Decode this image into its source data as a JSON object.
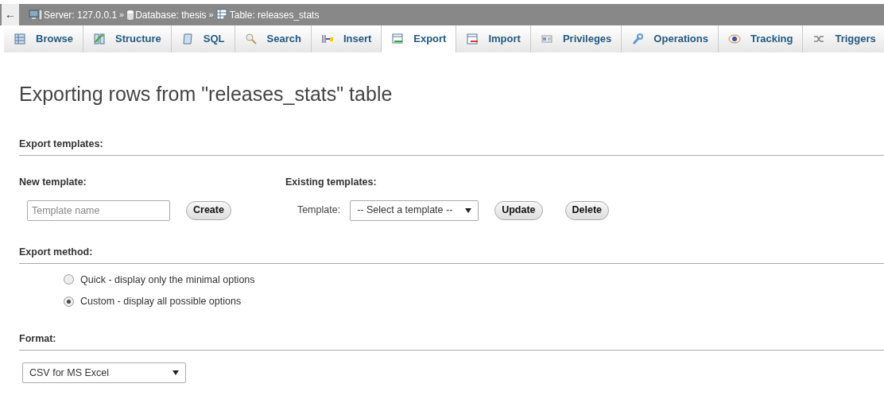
{
  "nav": {
    "back": "←",
    "breadcrumbs": [
      {
        "kind": "server",
        "label": "Server: 127.0.0.1"
      },
      {
        "kind": "separator",
        "label": "»"
      },
      {
        "kind": "database",
        "label": "Database: thesis"
      },
      {
        "kind": "separator",
        "label": "»"
      },
      {
        "kind": "table",
        "label": "Table: releases_stats"
      }
    ]
  },
  "tabs": [
    {
      "kind": "browse",
      "label": "Browse",
      "selected": false
    },
    {
      "kind": "structure",
      "label": "Structure",
      "selected": false
    },
    {
      "kind": "sql",
      "label": "SQL",
      "selected": false
    },
    {
      "kind": "search",
      "label": "Search",
      "selected": false
    },
    {
      "kind": "insert",
      "label": "Insert",
      "selected": false
    },
    {
      "kind": "export",
      "label": "Export",
      "selected": true
    },
    {
      "kind": "import",
      "label": "Import",
      "selected": false
    },
    {
      "kind": "privileges",
      "label": "Privileges",
      "selected": false
    },
    {
      "kind": "operations",
      "label": "Operations",
      "selected": false
    },
    {
      "kind": "tracking",
      "label": "Tracking",
      "selected": false
    },
    {
      "kind": "triggers",
      "label": "Triggers",
      "selected": false
    }
  ],
  "title": "Exporting rows from \"releases_stats\" table",
  "templates": {
    "heading": "Export templates:",
    "new_heading": "New template:",
    "name_placeholder": "Template name",
    "create": "Create",
    "existing_heading": "Existing templates:",
    "template_label": "Template:",
    "template_select": "-- Select a template --",
    "update": "Update",
    "delete": "Delete"
  },
  "method": {
    "heading": "Export method:",
    "options": [
      {
        "label": "Quick - display only the minimal options",
        "selected": false
      },
      {
        "label": "Custom - display all possible options",
        "selected": true
      }
    ]
  },
  "format": {
    "heading": "Format:",
    "value": "CSV for MS Excel"
  }
}
